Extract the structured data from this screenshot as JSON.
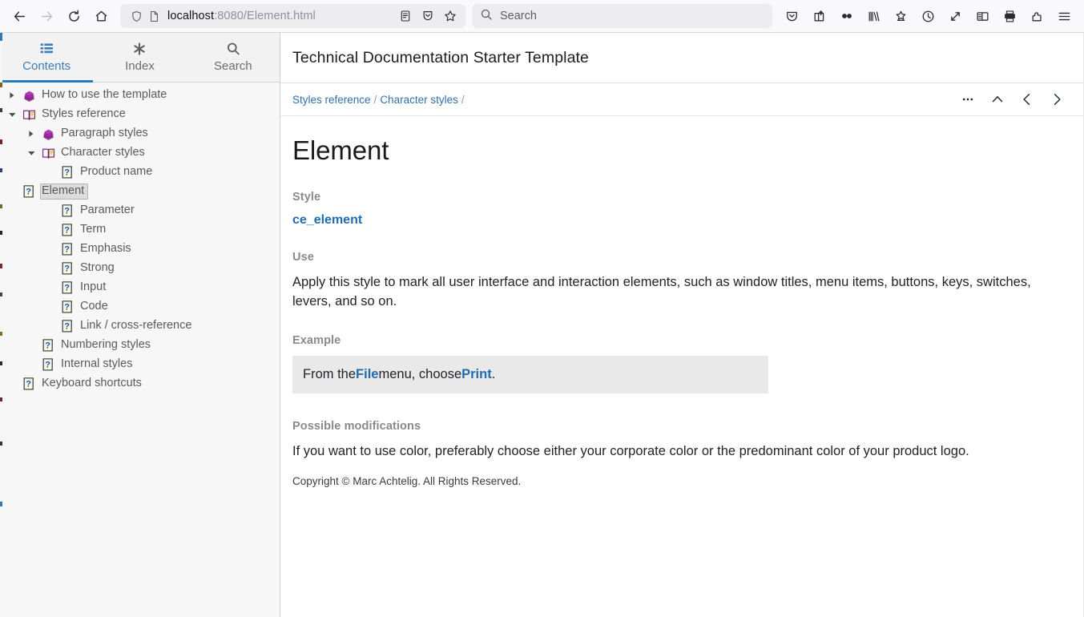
{
  "browser": {
    "nav": {
      "back": "back-arrow",
      "forward": "forward-arrow",
      "reload": "reload",
      "home": "home"
    },
    "urlbar": {
      "shield_icon": "shield-icon",
      "page_icon": "page-icon",
      "host": "localhost",
      "path": ":8080/Element.html",
      "reader_icon": "reader-view-icon",
      "save_icon": "save-to-pocket-icon",
      "bookmark_icon": "star-icon"
    },
    "search": {
      "placeholder": "Search",
      "icon": "search-icon"
    },
    "toolbar_icons": [
      {
        "name": "pocket-icon",
        "title": "Save to Pocket"
      },
      {
        "name": "share-icon",
        "title": "Share"
      },
      {
        "name": "infinity-icon",
        "title": "Extension"
      },
      {
        "name": "library-icon",
        "title": "Library"
      },
      {
        "name": "bookmark-star-icon",
        "title": "Bookmarks"
      },
      {
        "name": "history-clock-icon",
        "title": "History"
      },
      {
        "name": "fullscreen-icon",
        "title": "Full screen"
      },
      {
        "name": "sidebar-icon",
        "title": "Sidebars"
      },
      {
        "name": "print-icon",
        "title": "Print"
      },
      {
        "name": "extension-puzzle-icon",
        "title": "Extensions"
      },
      {
        "name": "hamburger-menu-icon",
        "title": "Open application menu"
      }
    ]
  },
  "sidebar": {
    "tabs": [
      {
        "label": "Contents",
        "icon": "list-icon",
        "active": true
      },
      {
        "label": "Index",
        "icon": "asterisk-icon",
        "active": false
      },
      {
        "label": "Search",
        "icon": "magnifier-icon",
        "active": false
      }
    ],
    "tree": [
      {
        "label": "How to use the template",
        "level": 0,
        "twist": "collapsed",
        "icon": "book-closed-icon",
        "selected": false
      },
      {
        "label": "Styles reference",
        "level": 0,
        "twist": "expanded",
        "icon": "book-open-icon",
        "selected": false
      },
      {
        "label": "Paragraph styles",
        "level": 1,
        "twist": "collapsed",
        "icon": "book-closed-icon",
        "selected": false
      },
      {
        "label": "Character styles",
        "level": 1,
        "twist": "expanded",
        "icon": "book-open-icon",
        "selected": false
      },
      {
        "label": "Product name",
        "level": 2,
        "twist": "none",
        "icon": "help-page-icon",
        "selected": false
      },
      {
        "label": "Element",
        "level": 2,
        "twist": "none",
        "icon": "help-page-icon",
        "selected": true
      },
      {
        "label": "Parameter",
        "level": 2,
        "twist": "none",
        "icon": "help-page-icon",
        "selected": false
      },
      {
        "label": "Term",
        "level": 2,
        "twist": "none",
        "icon": "help-page-icon",
        "selected": false
      },
      {
        "label": "Emphasis",
        "level": 2,
        "twist": "none",
        "icon": "help-page-icon",
        "selected": false
      },
      {
        "label": "Strong",
        "level": 2,
        "twist": "none",
        "icon": "help-page-icon",
        "selected": false
      },
      {
        "label": "Input",
        "level": 2,
        "twist": "none",
        "icon": "help-page-icon",
        "selected": false
      },
      {
        "label": "Code",
        "level": 2,
        "twist": "none",
        "icon": "help-page-icon",
        "selected": false
      },
      {
        "label": "Link / cross-reference",
        "level": 2,
        "twist": "none",
        "icon": "help-page-icon",
        "selected": false
      },
      {
        "label": "Numbering styles",
        "level": 1,
        "twist": "none",
        "icon": "help-page-icon",
        "selected": false
      },
      {
        "label": "Internal styles",
        "level": 1,
        "twist": "none",
        "icon": "help-page-icon",
        "selected": false
      },
      {
        "label": "Keyboard shortcuts",
        "level": 0,
        "twist": "none",
        "icon": "help-page-icon",
        "selected": false
      }
    ]
  },
  "header": {
    "title": "Technical Documentation Starter Template"
  },
  "breadcrumb": {
    "items": [
      {
        "label": "Styles reference"
      },
      {
        "label": "Character styles"
      }
    ],
    "separator": "/",
    "actions": [
      {
        "name": "more-options-button",
        "glyph": "•••"
      },
      {
        "name": "parent-topic-button",
        "glyph": "chevron-up"
      },
      {
        "name": "previous-topic-button",
        "glyph": "chevron-left"
      },
      {
        "name": "next-topic-button",
        "glyph": "chevron-right"
      }
    ]
  },
  "main": {
    "page_title": "Element",
    "sections": {
      "style_label": "Style",
      "style_value": "ce_element",
      "use_label": "Use",
      "use_text": "Apply this style to mark all user interface and interaction elements, such as window titles, menu items, buttons, keys, switches, levers, and so on.",
      "example_label": "Example",
      "example_prefix": "From the ",
      "example_bold1": "File",
      "example_mid": " menu, choose ",
      "example_bold2": "Print",
      "example_suffix": ".",
      "modifications_label": "Possible modifications",
      "modifications_text": "If you want to use color, preferably choose either your corporate color or the predominant color of your product logo."
    },
    "copyright": "Copyright © Marc Achtelig. All Rights Reserved."
  },
  "colors": {
    "accent_blue": "#2b7bba",
    "link_blue": "#1f6cb0",
    "tree_icon_purple": "#7b1fa2",
    "example_bg": "#e9e9e9",
    "sidebar_bg": "#f7f7f7"
  }
}
